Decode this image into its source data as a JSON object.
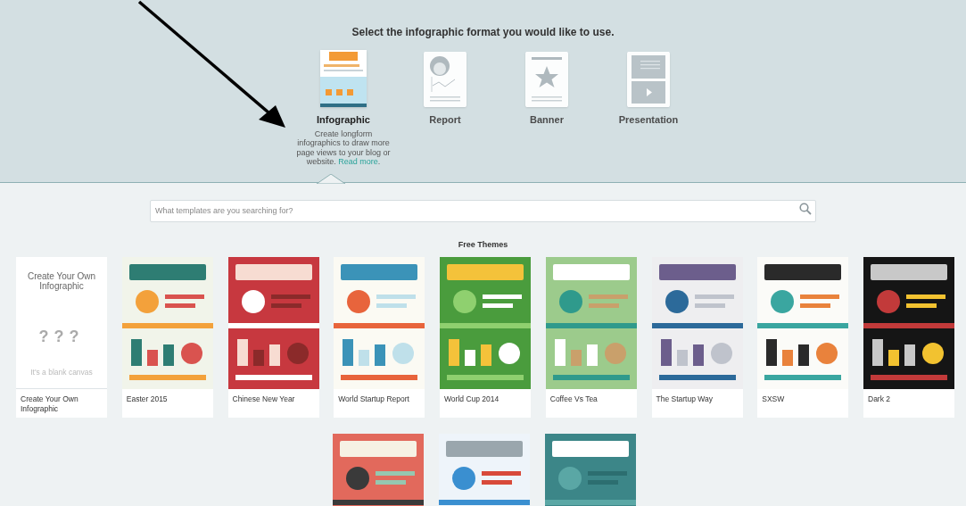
{
  "header": {
    "title": "Select the infographic format you would like to use."
  },
  "formats": [
    {
      "kind": "picture",
      "label": "Infographic",
      "selected": true,
      "description": "Create longform infographics to draw more page views to your blog or website.",
      "link": "Read more",
      "description_end": "."
    },
    {
      "kind": "report",
      "label": "Report",
      "selected": false
    },
    {
      "kind": "banner",
      "label": "Banner",
      "selected": false
    },
    {
      "kind": "presentation",
      "label": "Presentation",
      "selected": false
    }
  ],
  "search": {
    "placeholder": "What templates are you searching for?"
  },
  "section_title": "Free Themes",
  "templates": [
    {
      "kind": "blank",
      "name": "Create Your Own Infographic",
      "preview_title": "Create Your Own Infographic",
      "preview_marks": "?",
      "preview_note": "It's a blank canvas"
    },
    {
      "kind": "picture",
      "name": "Easter 2015"
    },
    {
      "kind": "picture",
      "name": "Chinese New Year"
    },
    {
      "kind": "picture",
      "name": "World Startup Report"
    },
    {
      "kind": "picture",
      "name": "World Cup 2014"
    },
    {
      "kind": "picture",
      "name": "Coffee Vs Tea"
    },
    {
      "kind": "picture",
      "name": "The Startup Way"
    },
    {
      "kind": "picture",
      "name": "SXSW"
    },
    {
      "kind": "picture",
      "name": "Dark 2"
    }
  ]
}
